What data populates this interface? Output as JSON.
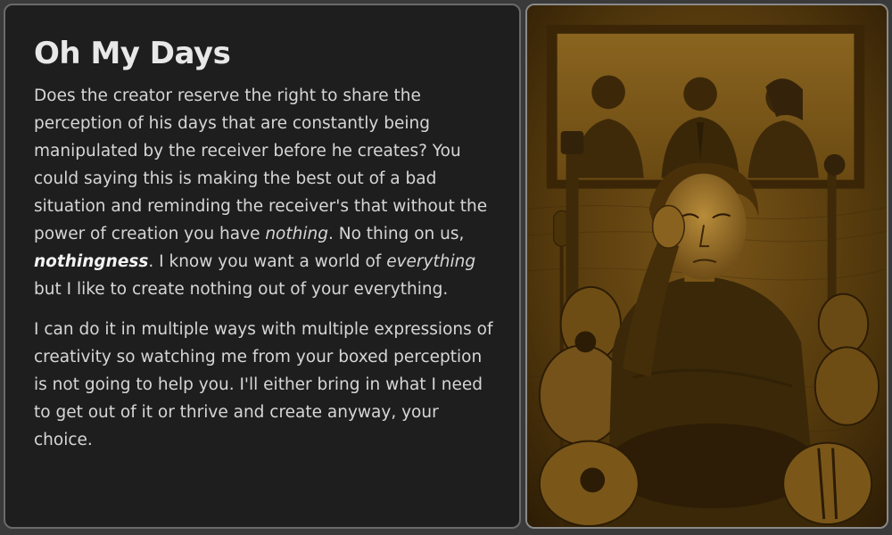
{
  "article": {
    "title": "Oh My Days",
    "p1": {
      "s1": "Does the creator reserve the right to share the perception of his days that are constantly being manipulated by the receiver before he creates? You could saying this is making the best out of a bad situation and reminding the receiver's that without the power of creation you have ",
      "em1": "nothing",
      "s2": ". No thing on us, ",
      "strong_em": "nothingness",
      "s3": ". I know you want a world of ",
      "em2": "everything",
      "s4": " but I like to create nothing out of your everything."
    },
    "p2": "I can do it in multiple ways with multiple expressions of creativity so watching me from your boxed perception is not going to help you. I'll either bring in what I need to get out of it or thrive and create anyway, your choice."
  },
  "artwork": {
    "subject": "sepia painting of a pensive man with hand on forehead surrounded by guitars, violin and a vintage microphone, with three figures in a framed picture behind him",
    "palette": {
      "dark": "#2e1d06",
      "mid": "#6b4a14",
      "light": "#a8802e",
      "highlight": "#c9a24a"
    }
  }
}
